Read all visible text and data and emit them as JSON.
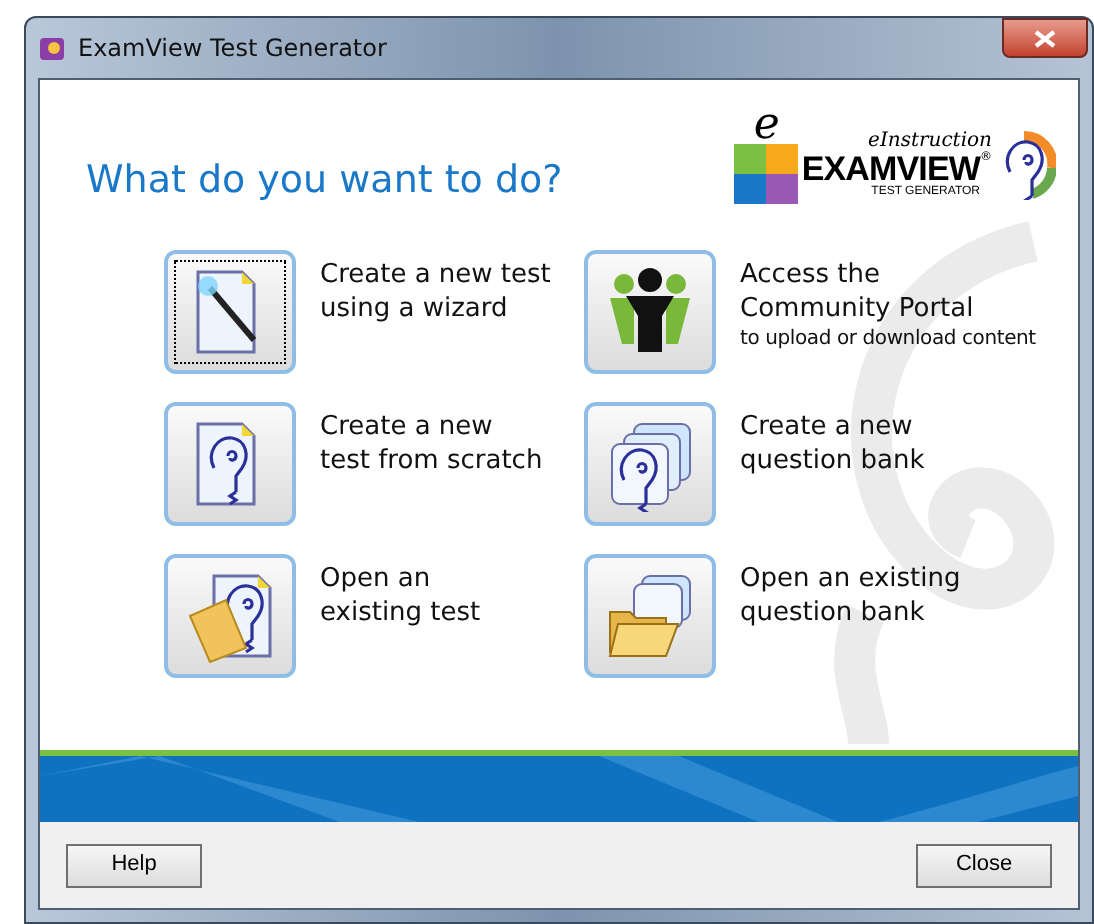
{
  "window": {
    "title": "ExamView Test Generator"
  },
  "heading": "What do you want to do?",
  "logo": {
    "mark": "e",
    "brand": "eInstruction",
    "product": "EXAMVIEW",
    "reg": "®",
    "tagline": "TEST GENERATOR"
  },
  "actions": [
    {
      "kind": "wizard",
      "lines": [
        "Create a new test",
        "using a wizard"
      ],
      "focused": true
    },
    {
      "kind": "community",
      "lines": [
        "Access the",
        "Community Portal"
      ],
      "note": "to upload or download content",
      "focused": false
    },
    {
      "kind": "scratch",
      "lines": [
        "Create a new",
        "test from scratch"
      ],
      "focused": false
    },
    {
      "kind": "new-bank",
      "lines": [
        "Create a new",
        "question bank"
      ],
      "focused": false
    },
    {
      "kind": "open-test",
      "lines": [
        "Open an",
        "existing test"
      ],
      "focused": false
    },
    {
      "kind": "open-bank",
      "lines": [
        "Open an existing",
        "question bank"
      ],
      "focused": false
    }
  ],
  "buttons": [
    "Help",
    "Close"
  ]
}
